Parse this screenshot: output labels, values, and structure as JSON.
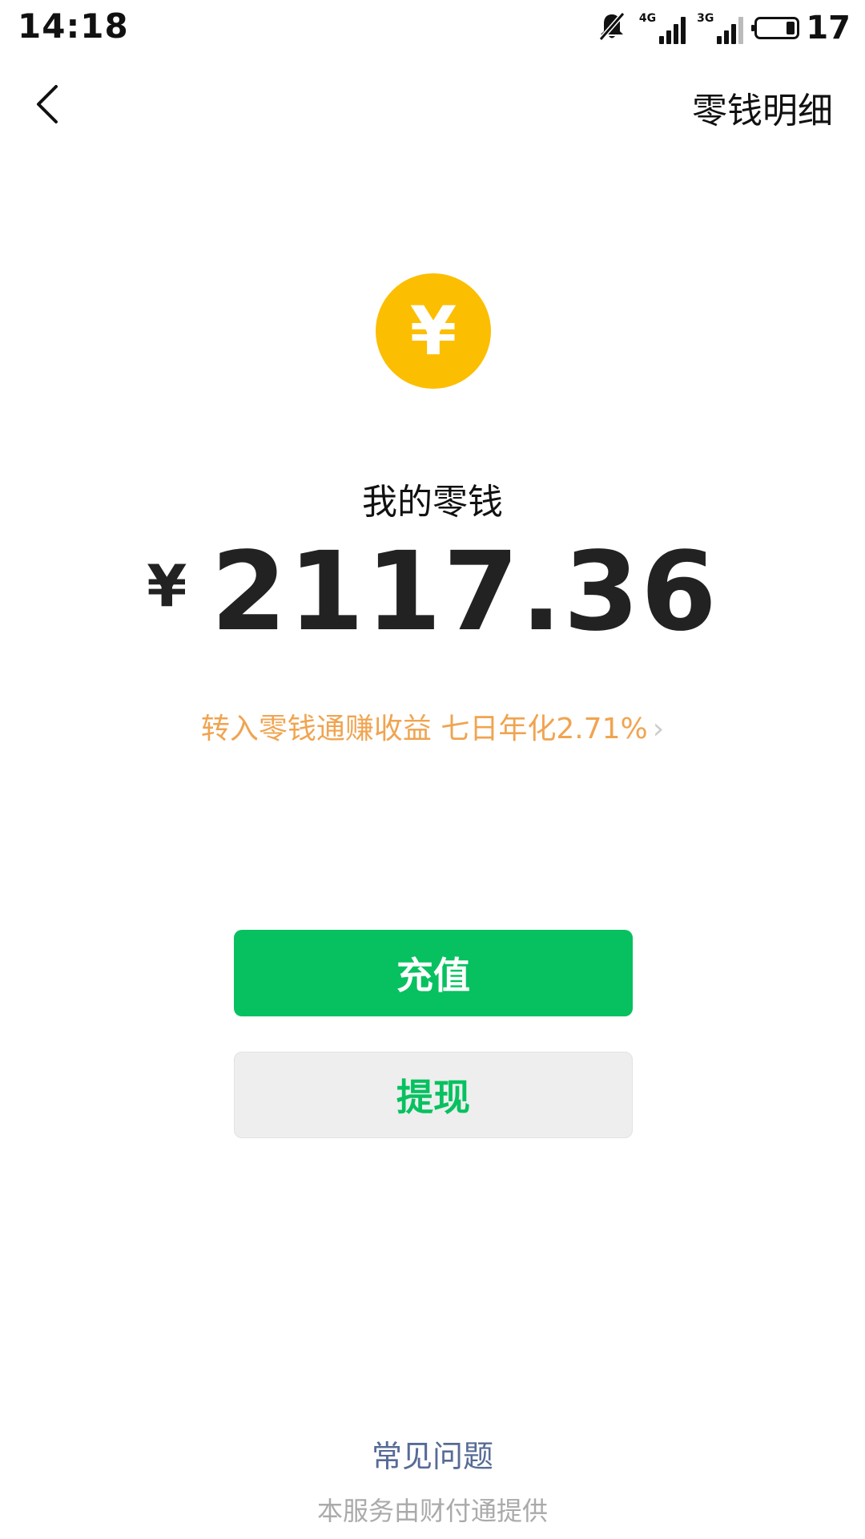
{
  "status_bar": {
    "time": "14:18",
    "network_1": "4G",
    "network_2": "3G",
    "battery": "17",
    "icons": [
      "bell-muted-icon",
      "signal-4g-icon",
      "signal-3g-icon",
      "battery-icon"
    ]
  },
  "header": {
    "back_icon": "chevron-left-icon",
    "detail_link": "零钱明细"
  },
  "wallet": {
    "coin_symbol": "¥",
    "title": "我的零钱",
    "currency": "¥",
    "amount": "2117.36",
    "promo": "转入零钱通赚收益 七日年化2.71%",
    "promo_arrow": "›"
  },
  "actions": {
    "recharge": "充值",
    "withdraw": "提现"
  },
  "footer": {
    "faq": "常见问题",
    "provider": "本服务由财付通提供"
  },
  "colors": {
    "primary_green": "#07c160",
    "coin_yellow": "#fcbe00",
    "promo_orange": "#f0a450",
    "link_blue": "#576b95",
    "muted_gray": "#aaaaaa"
  }
}
